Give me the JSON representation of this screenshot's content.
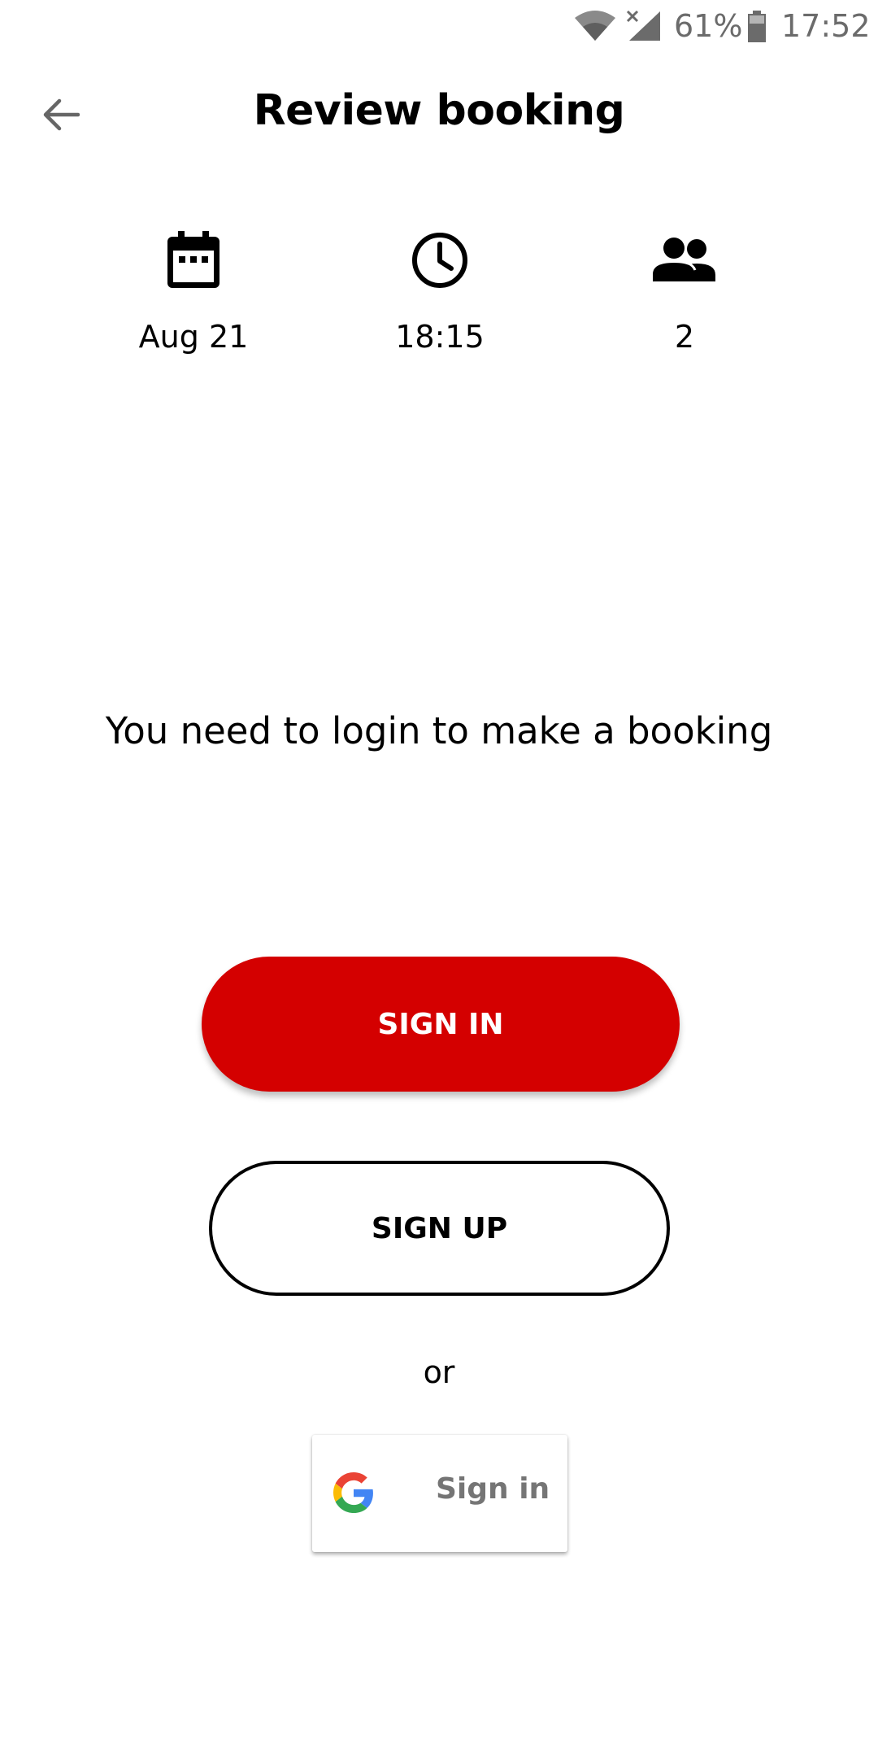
{
  "status_bar": {
    "battery": "61%",
    "time": "17:52"
  },
  "header": {
    "title": "Review booking"
  },
  "booking_summary": {
    "date": "Aug 21",
    "time": "18:15",
    "party_size": "2"
  },
  "login": {
    "message": "You need to login to make a booking",
    "sign_in_label": "SIGN IN",
    "sign_up_label": "SIGN UP",
    "or_label": "or",
    "google_label": "Sign in"
  },
  "colors": {
    "accent": "#d40000"
  },
  "icons": [
    "wifi-icon",
    "signal-icon",
    "battery-icon",
    "back-arrow-icon",
    "calendar-icon",
    "clock-icon",
    "people-icon",
    "google-logo-icon"
  ]
}
